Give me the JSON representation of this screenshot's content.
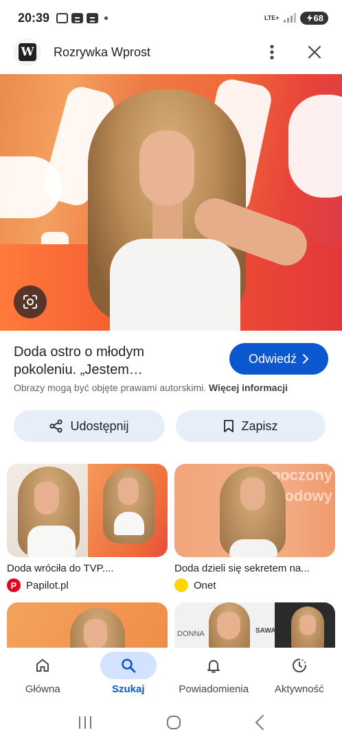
{
  "status_bar": {
    "time": "20:39",
    "network": "LTE+",
    "battery": "68"
  },
  "header": {
    "site_logo_letter": "W",
    "site_name": "Rozrywka Wprost"
  },
  "result": {
    "title": "Doda ostro o młodym pokoleniu. „Jestem…",
    "title_line1": "Doda ostro o młodym",
    "title_line2": "pokoleniu. „Jestem…",
    "visit_label": "Odwiedź",
    "copyright_text": "Obrazy mogą być objęte prawami autorskimi.",
    "copyright_link": "Więcej informacji",
    "share_label": "Udostępnij",
    "save_label": "Zapisz"
  },
  "related": [
    {
      "title": "Doda wróciła do TVP....",
      "source": "Papilot.pl",
      "source_icon_letter": "P",
      "source_color": "#e60023"
    },
    {
      "title": "Doda dzieli się sekretem na...",
      "source": "Onet",
      "source_icon_letter": "",
      "source_color": "#ffd600",
      "image_text_line1": "Rozpoczony",
      "image_text_line2": "Podowy"
    },
    {
      "title": "",
      "source": ""
    },
    {
      "title": "",
      "source": "",
      "image_text_line1": "DONNA",
      "image_text_line2": "SAWA"
    }
  ],
  "bottom_nav": [
    {
      "label": "Główna",
      "icon": "home-icon",
      "active": false
    },
    {
      "label": "Szukaj",
      "icon": "search-icon",
      "active": true
    },
    {
      "label": "Powiadomienia",
      "icon": "bell-icon",
      "active": false
    },
    {
      "label": "Aktywność",
      "icon": "activity-icon",
      "active": false
    }
  ],
  "colors": {
    "accent": "#0b57d0",
    "active_nav_bg": "#d3e3fd",
    "action_button_bg": "#e8eef9"
  }
}
